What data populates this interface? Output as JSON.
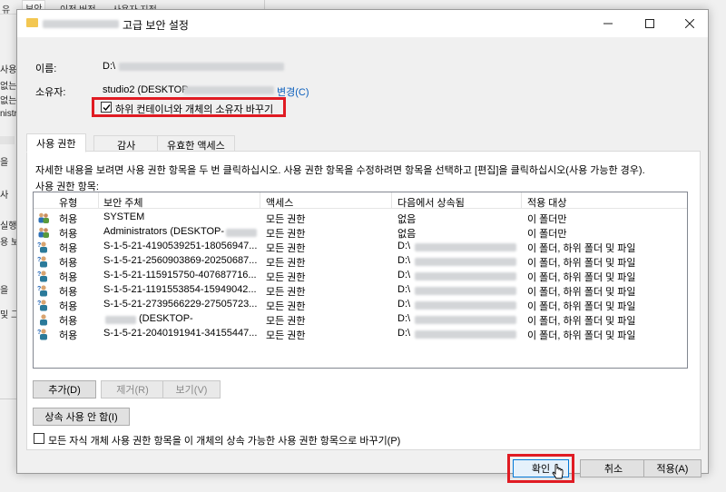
{
  "background_window": {
    "tabs": [
      "유",
      "보안",
      "이전 버전",
      "사용자 지정"
    ],
    "fragments": [
      "사용",
      "없는",
      "없는",
      "nistr",
      "을",
      "사",
      "실행",
      "용 보",
      "을",
      "및 그"
    ]
  },
  "dialog": {
    "title": "고급 보안 설정",
    "name_label": "이름:",
    "name_value": "D:\\",
    "owner_label": "소유자:",
    "owner_value": "studio2 (DESKTOP-",
    "owner_change_link": "변경(C)",
    "replace_owner_label": "하위 컨테이너와 개체의 소유자 바꾸기",
    "replace_owner_checked": true,
    "tabs": [
      {
        "label": "사용 권한",
        "active": true
      },
      {
        "label": "감사",
        "active": false
      },
      {
        "label": "유효한 액세스",
        "active": false
      }
    ],
    "instructions": "자세한 내용을 보려면 사용 권한 항목을 두 번 클릭하십시오. 사용 권한 항목을 수정하려면 항목을 선택하고 [편집]을 클릭하십시오(사용 가능한 경우).",
    "entries_label": "사용 권한 항목:",
    "columns": [
      "유형",
      "보안 주체",
      "액세스",
      "다음에서 상속됨",
      "적용 대상"
    ],
    "rows": [
      {
        "icon": "group-users-icon",
        "type": "허용",
        "principal": "SYSTEM",
        "access": "모든 권한",
        "inherited": "없음",
        "applies": "이 폴더만"
      },
      {
        "icon": "group-users-icon",
        "type": "허용",
        "principal": "Administrators (DESKTOP-",
        "access": "모든 권한",
        "inherited": "없음",
        "applies": "이 폴더만"
      },
      {
        "icon": "unknown-user-icon",
        "type": "허용",
        "principal": "S-1-5-21-4190539251-18056947...",
        "access": "모든 권한",
        "inherited": "D:\\",
        "applies": "이 폴더, 하위 폴더 및 파일"
      },
      {
        "icon": "unknown-user-icon",
        "type": "허용",
        "principal": "S-1-5-21-2560903869-20250687...",
        "access": "모든 권한",
        "inherited": "D:\\",
        "applies": "이 폴더, 하위 폴더 및 파일"
      },
      {
        "icon": "unknown-user-icon",
        "type": "허용",
        "principal": "S-1-5-21-115915750-407687716...",
        "access": "모든 권한",
        "inherited": "D:\\",
        "applies": "이 폴더, 하위 폴더 및 파일"
      },
      {
        "icon": "unknown-user-icon",
        "type": "허용",
        "principal": "S-1-5-21-1191553854-15949042...",
        "access": "모든 권한",
        "inherited": "D:\\",
        "applies": "이 폴더, 하위 폴더 및 파일"
      },
      {
        "icon": "unknown-user-icon",
        "type": "허용",
        "principal": "S-1-5-21-2739566229-27505723...",
        "access": "모든 권한",
        "inherited": "D:\\",
        "applies": "이 폴더, 하위 폴더 및 파일"
      },
      {
        "icon": "user-icon",
        "type": "허용",
        "principal": "(DESKTOP-",
        "access": "모든 권한",
        "inherited": "D:\\",
        "applies": "이 폴더, 하위 폴더 및 파일"
      },
      {
        "icon": "unknown-user-icon",
        "type": "허용",
        "principal": "S-1-5-21-2040191941-34155447...",
        "access": "모든 권한",
        "inherited": "D:\\",
        "applies": "이 폴더, 하위 폴더 및 파일"
      }
    ],
    "add_button": "추가(D)",
    "remove_button": "제거(R)",
    "view_button": "보기(V)",
    "disable_inheritance_button": "상속 사용 안 함(I)",
    "replace_child_label": "모든 자식 개체 사용 권한 항목을 이 개체의 상속 가능한 사용 권한 항목으로 바꾸기(P)",
    "replace_child_checked": false,
    "ok_button": "확인",
    "cancel_button": "취소",
    "apply_button": "적용(A)"
  },
  "colors": {
    "highlight": "#e01b23",
    "link": "#0a5ebc"
  }
}
